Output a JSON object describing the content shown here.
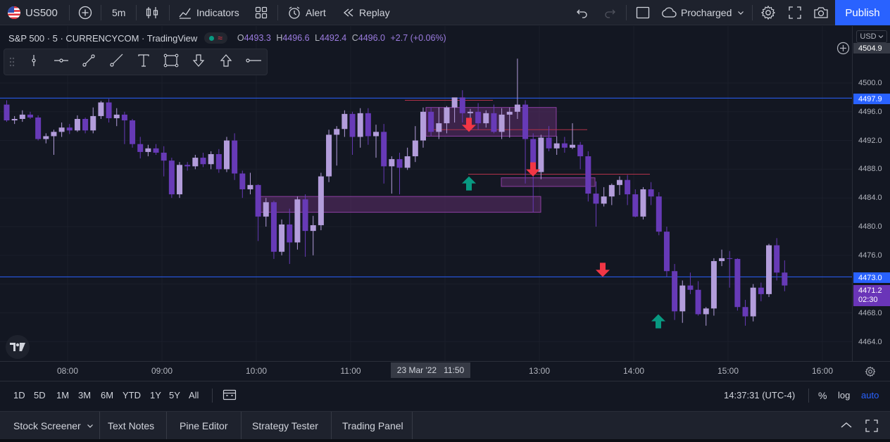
{
  "toolbar": {
    "symbol": "US500",
    "interval": "5m",
    "indicators_label": "Indicators",
    "alert_label": "Alert",
    "replay_label": "Replay",
    "layout_name": "Procharged",
    "publish_label": "Publish"
  },
  "legend": {
    "title": "S&P 500 · 5 · CURRENCYCOM · TradingView",
    "open_key": "O",
    "open": "4493.3",
    "high_key": "H",
    "high": "4496.6",
    "low_key": "L",
    "low": "4492.4",
    "close_key": "C",
    "close": "4496.0",
    "change": "+2.7 (+0.06%)"
  },
  "price_axis": {
    "currency": "USD",
    "ticks": [
      "4500.0",
      "4496.0",
      "4492.0",
      "4488.0",
      "4484.0",
      "4480.0",
      "4476.0",
      "4468.0",
      "4464.0"
    ],
    "crosshair_price": "4504.9",
    "line_high": "4497.9",
    "line_low": "4473.0",
    "last_price": "4471.2",
    "countdown": "02:30"
  },
  "time_axis": {
    "ticks": [
      "08:00",
      "09:00",
      "10:00",
      "11:00",
      "13:00",
      "14:00",
      "15:00",
      "16:00"
    ],
    "crosshair_date": "23 Mar '22",
    "crosshair_time": "11:50"
  },
  "ranges": [
    "1D",
    "5D",
    "1M",
    "3M",
    "6M",
    "YTD",
    "1Y",
    "5Y",
    "All"
  ],
  "status": {
    "clock": "14:37:31 (UTC-4)",
    "percent": "%",
    "log": "log",
    "auto": "auto"
  },
  "panels": [
    "Stock Screener",
    "Text Notes",
    "Pine Editor",
    "Strategy Tester",
    "Trading Panel"
  ],
  "colors": {
    "up": "#b39ddb",
    "down": "#673ab7",
    "accent": "#2962ff",
    "zone_fill": "#5e2e6b",
    "zone_border": "#8e3fa3",
    "signal_up": "#089981",
    "signal_down": "#f23645",
    "level_line": "#2962ff",
    "last_price_bg": "#6a35b8"
  },
  "icons": [
    "us-flag-icon",
    "plus-icon",
    "candles-icon",
    "indicators-icon",
    "templates-icon",
    "alert-icon",
    "replay-icon",
    "undo-icon",
    "redo-icon",
    "layout-icon",
    "cloud-icon",
    "settings-icon",
    "fullscreen-icon",
    "camera-icon"
  ]
}
